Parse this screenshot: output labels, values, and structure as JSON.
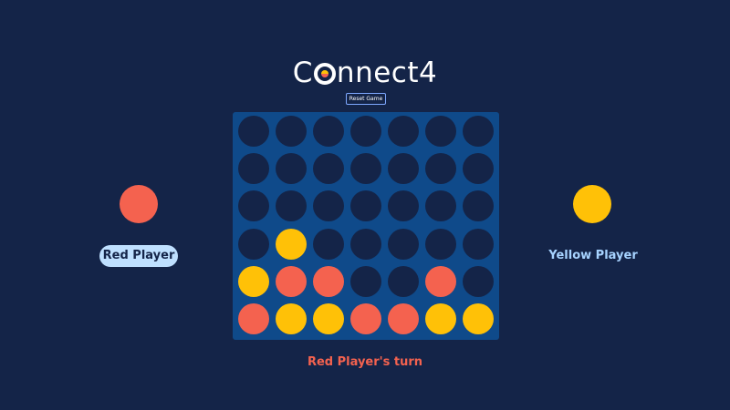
{
  "title": {
    "prefix": "C",
    "suffix": "nnect4"
  },
  "reset_button": {
    "label": "Reset Game"
  },
  "players": {
    "red": {
      "name": "Red Player",
      "color": "#f4624f",
      "active": true
    },
    "yellow": {
      "name": "Yellow Player",
      "color": "#ffc107",
      "active": false
    }
  },
  "status": {
    "text": "Red Player's turn",
    "color": "#f4624f"
  },
  "colors": {
    "background": "#142448",
    "board": "#0f4a8a",
    "empty_cell": "#142448",
    "red": "#f4624f",
    "yellow": "#ffc107",
    "active_label_bg": "#bfe0ff",
    "inactive_label": "#a7d3ff"
  },
  "board": {
    "rows": 6,
    "columns": 7,
    "cells": [
      [
        "empty",
        "empty",
        "empty",
        "empty",
        "empty",
        "empty",
        "empty"
      ],
      [
        "empty",
        "empty",
        "empty",
        "empty",
        "empty",
        "empty",
        "empty"
      ],
      [
        "empty",
        "empty",
        "empty",
        "empty",
        "empty",
        "empty",
        "empty"
      ],
      [
        "empty",
        "yellow",
        "empty",
        "empty",
        "empty",
        "empty",
        "empty"
      ],
      [
        "yellow",
        "red",
        "red",
        "empty",
        "empty",
        "red",
        "empty"
      ],
      [
        "red",
        "yellow",
        "yellow",
        "red",
        "red",
        "yellow",
        "yellow"
      ]
    ]
  }
}
